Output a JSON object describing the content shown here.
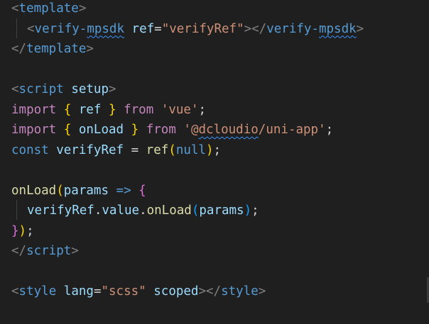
{
  "editor": {
    "theme_colors": {
      "background": "#1f1f1f",
      "tag": "#569cd6",
      "attribute": "#9cdcfe",
      "string": "#ce9178",
      "keyword": "#c586c0",
      "function": "#dcdcaa",
      "punctuation": "#808080"
    },
    "lines": [
      [
        {
          "t": "<",
          "c": "punct"
        },
        {
          "t": "template",
          "c": "tag"
        },
        {
          "t": ">",
          "c": "punct"
        }
      ],
      [
        {
          "t": "<",
          "c": "punct"
        },
        {
          "t": "verify-",
          "c": "tag"
        },
        {
          "t": "mpsdk",
          "c": "tag",
          "squiggle": true
        },
        {
          "t": " ",
          "c": "plain"
        },
        {
          "t": "ref",
          "c": "attr"
        },
        {
          "t": "=",
          "c": "plain"
        },
        {
          "t": "\"verifyRef\"",
          "c": "string"
        },
        {
          "t": "></",
          "c": "punct"
        },
        {
          "t": "verify-",
          "c": "tag"
        },
        {
          "t": "mpsdk",
          "c": "tag",
          "squiggle": true
        },
        {
          "t": ">",
          "c": "punct"
        }
      ],
      [
        {
          "t": "</",
          "c": "punct"
        },
        {
          "t": "template",
          "c": "tag"
        },
        {
          "t": ">",
          "c": "punct"
        }
      ],
      [],
      [
        {
          "t": "<",
          "c": "punct"
        },
        {
          "t": "script",
          "c": "tag"
        },
        {
          "t": " ",
          "c": "plain"
        },
        {
          "t": "setup",
          "c": "attr"
        },
        {
          "t": ">",
          "c": "punct"
        }
      ],
      [
        {
          "t": "import",
          "c": "keyword"
        },
        {
          "t": " ",
          "c": "plain"
        },
        {
          "t": "{",
          "c": "brace-1"
        },
        {
          "t": " ",
          "c": "plain"
        },
        {
          "t": "ref",
          "c": "var"
        },
        {
          "t": " ",
          "c": "plain"
        },
        {
          "t": "}",
          "c": "brace-1"
        },
        {
          "t": " ",
          "c": "plain"
        },
        {
          "t": "from",
          "c": "keyword"
        },
        {
          "t": " ",
          "c": "plain"
        },
        {
          "t": "'vue'",
          "c": "string"
        },
        {
          "t": ";",
          "c": "plain"
        }
      ],
      [
        {
          "t": "import",
          "c": "keyword"
        },
        {
          "t": " ",
          "c": "plain"
        },
        {
          "t": "{",
          "c": "brace-1"
        },
        {
          "t": " ",
          "c": "plain"
        },
        {
          "t": "onLoad",
          "c": "var"
        },
        {
          "t": " ",
          "c": "plain"
        },
        {
          "t": "}",
          "c": "brace-1"
        },
        {
          "t": " ",
          "c": "plain"
        },
        {
          "t": "from",
          "c": "keyword"
        },
        {
          "t": " ",
          "c": "plain"
        },
        {
          "t": "'@",
          "c": "string"
        },
        {
          "t": "dcloudio",
          "c": "string",
          "squiggle": true
        },
        {
          "t": "/uni-app'",
          "c": "string"
        },
        {
          "t": ";",
          "c": "plain"
        }
      ],
      [
        {
          "t": "const",
          "c": "blue"
        },
        {
          "t": " ",
          "c": "plain"
        },
        {
          "t": "verifyRef",
          "c": "var"
        },
        {
          "t": " = ",
          "c": "plain"
        },
        {
          "t": "ref",
          "c": "func"
        },
        {
          "t": "(",
          "c": "brace-1"
        },
        {
          "t": "null",
          "c": "blue"
        },
        {
          "t": ")",
          "c": "brace-1"
        },
        {
          "t": ";",
          "c": "plain"
        }
      ],
      [],
      [
        {
          "t": "onLoad",
          "c": "func"
        },
        {
          "t": "(",
          "c": "brace-1"
        },
        {
          "t": "params",
          "c": "var"
        },
        {
          "t": " ",
          "c": "plain"
        },
        {
          "t": "=>",
          "c": "blue"
        },
        {
          "t": " ",
          "c": "plain"
        },
        {
          "t": "{",
          "c": "brace-2"
        }
      ],
      [
        {
          "t": "verifyRef",
          "c": "var"
        },
        {
          "t": ".",
          "c": "plain"
        },
        {
          "t": "value",
          "c": "var"
        },
        {
          "t": ".",
          "c": "plain"
        },
        {
          "t": "onLoad",
          "c": "func"
        },
        {
          "t": "(",
          "c": "brace-3"
        },
        {
          "t": "params",
          "c": "var"
        },
        {
          "t": ")",
          "c": "brace-3"
        },
        {
          "t": ";",
          "c": "plain"
        }
      ],
      [
        {
          "t": "}",
          "c": "brace-2"
        },
        {
          "t": ")",
          "c": "brace-1"
        },
        {
          "t": ";",
          "c": "plain"
        }
      ],
      [
        {
          "t": "</",
          "c": "punct"
        },
        {
          "t": "script",
          "c": "tag"
        },
        {
          "t": ">",
          "c": "punct"
        }
      ],
      [],
      [
        {
          "t": "<",
          "c": "punct"
        },
        {
          "t": "style",
          "c": "tag"
        },
        {
          "t": " ",
          "c": "plain"
        },
        {
          "t": "lang",
          "c": "attr"
        },
        {
          "t": "=",
          "c": "plain"
        },
        {
          "t": "\"scss\"",
          "c": "string"
        },
        {
          "t": " ",
          "c": "plain"
        },
        {
          "t": "scoped",
          "c": "attr"
        },
        {
          "t": "></",
          "c": "punct"
        },
        {
          "t": "style",
          "c": "tag"
        },
        {
          "t": ">",
          "c": "punct"
        }
      ]
    ]
  }
}
